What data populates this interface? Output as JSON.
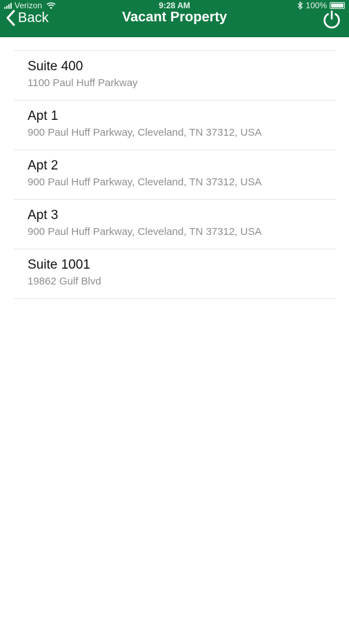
{
  "status_bar": {
    "carrier": "Verizon",
    "time": "9:28 AM",
    "battery": "100%",
    "battery_level": 1.0,
    "signal_icon": "signal-bars-icon",
    "wifi_icon": "wifi-icon",
    "bluetooth_icon": "bluetooth-icon"
  },
  "nav": {
    "back_label": "Back",
    "back_icon": "chevron-left-icon",
    "title": "Vacant Property",
    "power_icon": "power-icon"
  },
  "colors": {
    "header_bg": "#0f7a43",
    "title_text": "#111111",
    "subtitle_text": "#8e8e8e",
    "divider": "#e6e6e6"
  },
  "properties": [
    {
      "title": "Suite 400",
      "address": "1100 Paul Huff Parkway"
    },
    {
      "title": "Apt 1",
      "address": "900 Paul Huff Parkway, Cleveland, TN 37312, USA"
    },
    {
      "title": "Apt 2",
      "address": "900 Paul Huff Parkway, Cleveland, TN 37312, USA"
    },
    {
      "title": "Apt 3",
      "address": "900 Paul Huff Parkway, Cleveland, TN 37312, USA"
    },
    {
      "title": "Suite 1001",
      "address": "19862 Gulf Blvd"
    }
  ]
}
